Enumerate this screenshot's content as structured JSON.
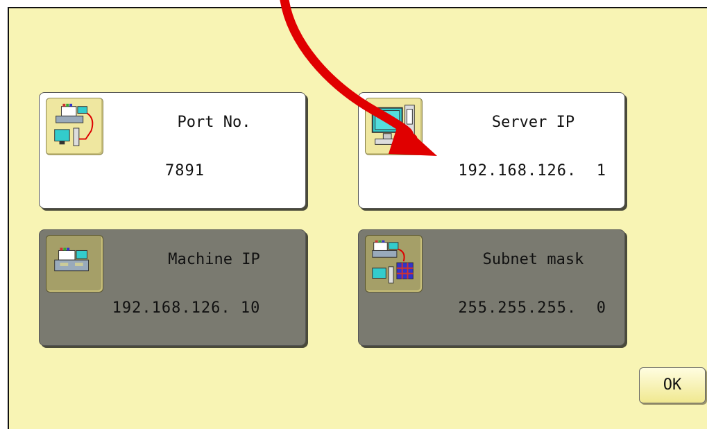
{
  "cards": {
    "port": {
      "title": "Port No.",
      "value": "7891",
      "icon": "network-machine-pc-icon",
      "state": "active"
    },
    "server_ip": {
      "title": "Server IP",
      "value": "192.168.126.  1",
      "icon": "server-computer-icon",
      "state": "active"
    },
    "machine_ip": {
      "title": "Machine IP",
      "value": "192.168.126. 10",
      "icon": "embroidery-machine-icon",
      "state": "disabled"
    },
    "subnet": {
      "title": "Subnet mask",
      "value": "255.255.255.  0",
      "icon": "subnet-network-icon",
      "state": "disabled"
    }
  },
  "ok_button": {
    "label": "OK"
  },
  "colors": {
    "panel_background": "#f8f4b4",
    "active_card": "#ffffff",
    "disabled_card": "#7a7a70",
    "annotation_arrow": "#e00000"
  }
}
